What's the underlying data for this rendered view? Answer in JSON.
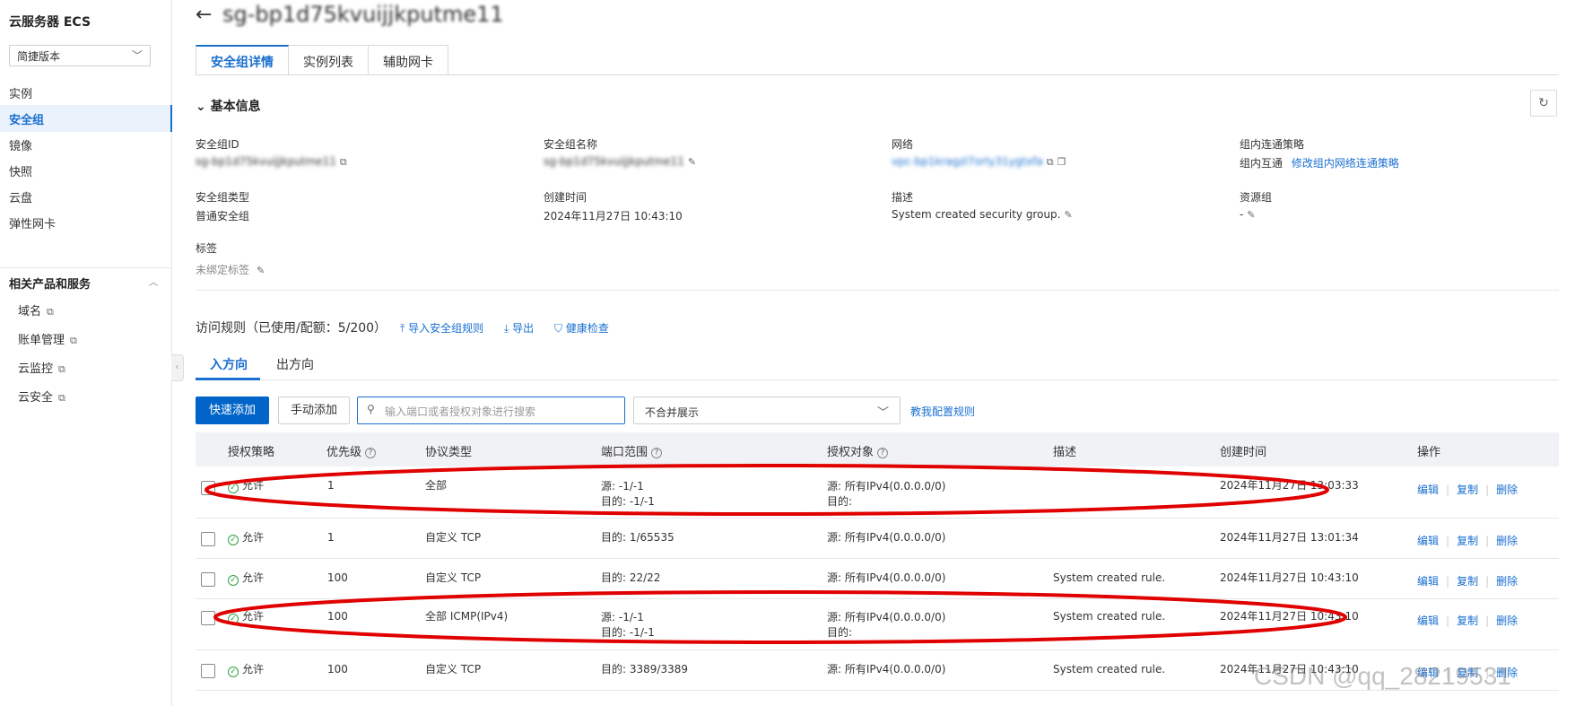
{
  "sidebar": {
    "title": "云服务器 ECS",
    "version_select": "简捷版本",
    "items": [
      {
        "label": "实例"
      },
      {
        "label": "安全组"
      },
      {
        "label": "镜像"
      },
      {
        "label": "快照"
      },
      {
        "label": "云盘"
      },
      {
        "label": "弹性网卡"
      }
    ],
    "related_title": "相关产品和服务",
    "related_items": [
      {
        "label": "域名"
      },
      {
        "label": "账单管理"
      },
      {
        "label": "云监控"
      },
      {
        "label": "云安全"
      }
    ]
  },
  "header": {
    "title": "sg-bp1d75kvuijjkputme11",
    "tabs": [
      {
        "label": "安全组详情"
      },
      {
        "label": "实例列表"
      },
      {
        "label": "辅助网卡"
      }
    ]
  },
  "basic_info": {
    "title": "基本信息",
    "fields": {
      "sg_id": {
        "label": "安全组ID",
        "value": "sg-bp1d75kvuijjkputme11"
      },
      "sg_name": {
        "label": "安全组名称",
        "value": "sg-bp1d75kvuijjkputme11"
      },
      "network": {
        "label": "网络",
        "value": "vpc-bp1kragzl7orly31ygtxfa"
      },
      "policy": {
        "label": "组内连通策略",
        "value": "组内互通",
        "link": "修改组内网络连通策略"
      },
      "sg_type": {
        "label": "安全组类型",
        "value": "普通安全组"
      },
      "created": {
        "label": "创建时间",
        "value": "2024年11月27日 10:43:10"
      },
      "desc": {
        "label": "描述",
        "value": "System created security group."
      },
      "resource_group": {
        "label": "资源组",
        "value": "-"
      },
      "tags": {
        "label": "标签",
        "value": "未绑定标签"
      }
    }
  },
  "rules": {
    "header": "访问规则（已使用/配额：5/200）",
    "import_label": "导入安全组规则",
    "export_label": "导出",
    "health_label": "健康检查",
    "direction_tabs": [
      "入方向",
      "出方向"
    ],
    "quick_add": "快速添加",
    "manual_add": "手动添加",
    "search_placeholder": "输入端口或者授权对象进行搜索",
    "merge_select": "不合并展示",
    "teach_link": "教我配置规则",
    "columns": [
      "授权策略",
      "优先级",
      "协议类型",
      "端口范围",
      "授权对象",
      "描述",
      "创建时间",
      "操作"
    ],
    "actions": [
      "编辑",
      "复制",
      "删除"
    ],
    "rows": [
      {
        "policy": "允许",
        "priority": "1",
        "protocol": "全部",
        "port1": "源: -1/-1",
        "port2": "目的: -1/-1",
        "obj1": "源: 所有IPv4(0.0.0.0/0)",
        "obj2": "目的:",
        "desc": "",
        "created": "2024年11月27日 13:03:33"
      },
      {
        "policy": "允许",
        "priority": "1",
        "protocol": "自定义 TCP",
        "port1": "目的: 1/65535",
        "port2": "",
        "obj1": "源: 所有IPv4(0.0.0.0/0)",
        "obj2": "",
        "desc": "",
        "created": "2024年11月27日 13:01:34"
      },
      {
        "policy": "允许",
        "priority": "100",
        "protocol": "自定义 TCP",
        "port1": "目的: 22/22",
        "port2": "",
        "obj1": "源: 所有IPv4(0.0.0.0/0)",
        "obj2": "",
        "desc": "System created rule.",
        "created": "2024年11月27日 10:43:10"
      },
      {
        "policy": "允许",
        "priority": "100",
        "protocol": "全部 ICMP(IPv4)",
        "port1": "源: -1/-1",
        "port2": "目的: -1/-1",
        "obj1": "源: 所有IPv4(0.0.0.0/0)",
        "obj2": "目的:",
        "desc": "System created rule.",
        "created": "2024年11月27日 10:43:10"
      },
      {
        "policy": "允许",
        "priority": "100",
        "protocol": "自定义 TCP",
        "port1": "目的: 3389/3389",
        "port2": "",
        "obj1": "源: 所有IPv4(0.0.0.0/0)",
        "obj2": "",
        "desc": "System created rule.",
        "created": "2024年11月27日 10:43:10"
      }
    ]
  },
  "watermark": "CSDN @qq_28219531",
  "colors": {
    "accent": "#1a6fd0",
    "primary_button": "#0064c8",
    "allow_green": "#2ea043",
    "annotation_red": "#e00000"
  },
  "icons": {
    "back": "arrow-left-icon",
    "refresh": "refresh-icon",
    "edit": "pencil-icon",
    "external": "external-link-icon",
    "search": "search-icon",
    "allow": "check-circle-icon"
  }
}
